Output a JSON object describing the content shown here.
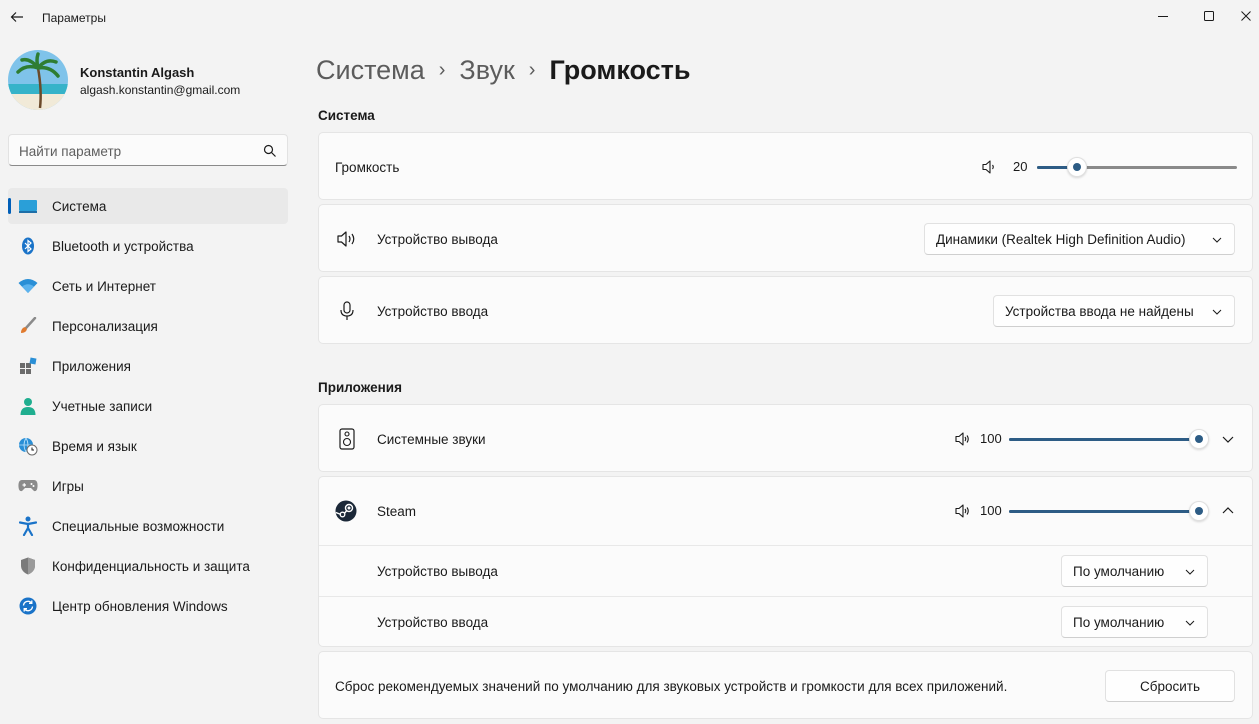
{
  "window": {
    "title": "Параметры"
  },
  "user": {
    "name": "Konstantin Algash",
    "email": "algash.konstantin@gmail.com"
  },
  "search": {
    "placeholder": "Найти параметр"
  },
  "sidebar": {
    "items": [
      {
        "label": "Система",
        "icon": "system-icon",
        "active": true
      },
      {
        "label": "Bluetooth и устройства",
        "icon": "bluetooth-icon"
      },
      {
        "label": "Сеть и Интернет",
        "icon": "wifi-icon"
      },
      {
        "label": "Персонализация",
        "icon": "brush-icon"
      },
      {
        "label": "Приложения",
        "icon": "apps-icon"
      },
      {
        "label": "Учетные записи",
        "icon": "account-icon"
      },
      {
        "label": "Время и язык",
        "icon": "globe-clock-icon"
      },
      {
        "label": "Игры",
        "icon": "gamepad-icon"
      },
      {
        "label": "Специальные возможности",
        "icon": "accessibility-icon"
      },
      {
        "label": "Конфиденциальность и защита",
        "icon": "shield-icon"
      },
      {
        "label": "Центр обновления Windows",
        "icon": "update-icon"
      }
    ]
  },
  "breadcrumb": {
    "items": [
      "Система",
      "Звук"
    ],
    "current": "Громкость"
  },
  "system_section": {
    "title": "Система",
    "volume": {
      "label": "Громкость",
      "value": "20",
      "level": 0.2
    },
    "output": {
      "label": "Устройство вывода",
      "selected": "Динамики (Realtek High Definition Audio)"
    },
    "input": {
      "label": "Устройство ввода",
      "selected": "Устройства ввода не найдены"
    }
  },
  "apps_section": {
    "title": "Приложения",
    "system_sounds": {
      "label": "Системные звуки",
      "value": "100",
      "level": 1.0
    },
    "steam": {
      "label": "Steam",
      "value": "100",
      "level": 1.0,
      "output_label": "Устройство вывода",
      "output_selected": "По умолчанию",
      "input_label": "Устройство ввода",
      "input_selected": "По умолчанию"
    }
  },
  "reset": {
    "text": "Сброс рекомендуемых значений по умолчанию для звуковых устройств и громкости для всех приложений.",
    "button": "Сбросить"
  },
  "colors": {
    "accent": "#005fb8",
    "slider": "#2d5c85",
    "background": "#f3f3f3",
    "card": "#fbfbfb"
  }
}
